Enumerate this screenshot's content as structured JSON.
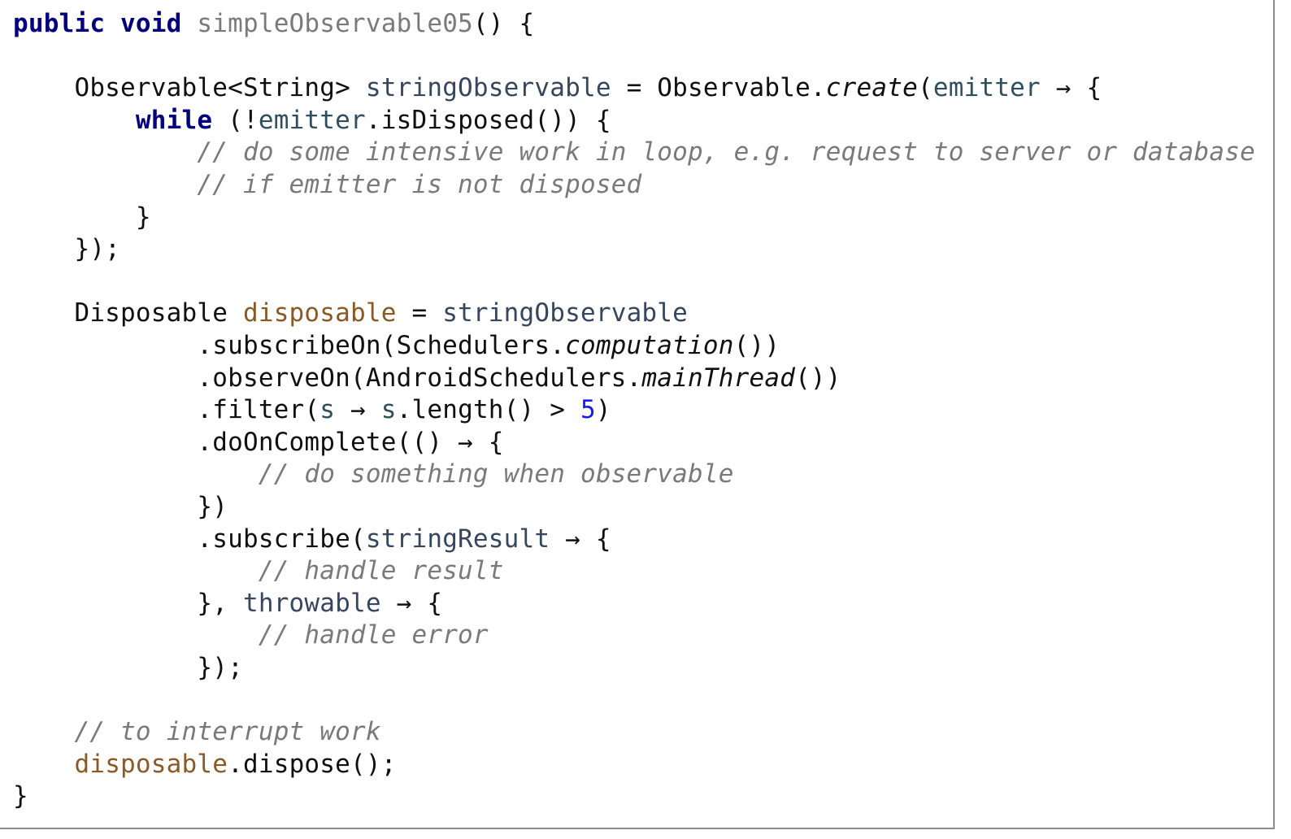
{
  "editor": {
    "lines": [
      [
        {
          "t": "public void ",
          "c": "kw"
        },
        {
          "t": "simpleObservable05",
          "c": "fn-name"
        },
        {
          "t": "() {",
          "c": ""
        }
      ],
      [],
      [
        {
          "t": "    Observable<String> ",
          "c": ""
        },
        {
          "t": "stringObservable",
          "c": "local"
        },
        {
          "t": " = Observable.",
          "c": ""
        },
        {
          "t": "create",
          "c": "static-call"
        },
        {
          "t": "(",
          "c": ""
        },
        {
          "t": "emitter",
          "c": "lambda-param"
        },
        {
          "t": " → {",
          "c": ""
        }
      ],
      [
        {
          "t": "        ",
          "c": ""
        },
        {
          "t": "while",
          "c": "kw"
        },
        {
          "t": " (!",
          "c": ""
        },
        {
          "t": "emitter",
          "c": "lambda-param"
        },
        {
          "t": ".isDisposed()) {",
          "c": ""
        }
      ],
      [
        {
          "t": "            ",
          "c": ""
        },
        {
          "t": "// do some intensive work in loop, e.g. request to server or database",
          "c": "comment"
        }
      ],
      [
        {
          "t": "            ",
          "c": ""
        },
        {
          "t": "// if emitter is not disposed",
          "c": "comment"
        }
      ],
      [
        {
          "t": "        }",
          "c": ""
        }
      ],
      [
        {
          "t": "    });",
          "c": ""
        }
      ],
      [],
      [
        {
          "t": "    Disposable ",
          "c": ""
        },
        {
          "t": "disposable",
          "c": "field"
        },
        {
          "t": " = ",
          "c": ""
        },
        {
          "t": "stringObservable",
          "c": "local"
        }
      ],
      [
        {
          "t": "            .subscribeOn(Schedulers.",
          "c": ""
        },
        {
          "t": "computation",
          "c": "static-call"
        },
        {
          "t": "())",
          "c": ""
        }
      ],
      [
        {
          "t": "            .observeOn(AndroidSchedulers.",
          "c": ""
        },
        {
          "t": "mainThread",
          "c": "static-call"
        },
        {
          "t": "())",
          "c": ""
        }
      ],
      [
        {
          "t": "            .filter(",
          "c": ""
        },
        {
          "t": "s",
          "c": "lambda-param"
        },
        {
          "t": " → ",
          "c": ""
        },
        {
          "t": "s",
          "c": "lambda-param"
        },
        {
          "t": ".length() > ",
          "c": ""
        },
        {
          "t": "5",
          "c": "num"
        },
        {
          "t": ")",
          "c": ""
        }
      ],
      [
        {
          "t": "            .doOnComplete(() → {",
          "c": ""
        }
      ],
      [
        {
          "t": "                ",
          "c": ""
        },
        {
          "t": "// do something when observable",
          "c": "comment"
        }
      ],
      [
        {
          "t": "            })",
          "c": ""
        }
      ],
      [
        {
          "t": "            .subscribe(",
          "c": ""
        },
        {
          "t": "stringResult",
          "c": "local"
        },
        {
          "t": " → {",
          "c": ""
        }
      ],
      [
        {
          "t": "                ",
          "c": ""
        },
        {
          "t": "// handle result",
          "c": "comment"
        }
      ],
      [
        {
          "t": "            }, ",
          "c": ""
        },
        {
          "t": "throwable",
          "c": "local"
        },
        {
          "t": " → {",
          "c": ""
        }
      ],
      [
        {
          "t": "                ",
          "c": ""
        },
        {
          "t": "// handle error",
          "c": "comment"
        }
      ],
      [
        {
          "t": "            });",
          "c": ""
        }
      ],
      [],
      [
        {
          "t": "    ",
          "c": ""
        },
        {
          "t": "// to interrupt work",
          "c": "comment"
        }
      ],
      [
        {
          "t": "    ",
          "c": ""
        },
        {
          "t": "disposable",
          "c": "field"
        },
        {
          "t": ".dispose();",
          "c": ""
        }
      ],
      [
        {
          "t": "}",
          "c": ""
        }
      ]
    ],
    "colors": {
      "keyword": "#00007f",
      "method_name": "#7a7a7a",
      "local_variable": "#36465d",
      "lambda_parameter": "#2e4f5c",
      "field": "#8a5a26",
      "number": "#1a1aee",
      "comment": "#7a7a7a",
      "text": "#101010"
    }
  }
}
